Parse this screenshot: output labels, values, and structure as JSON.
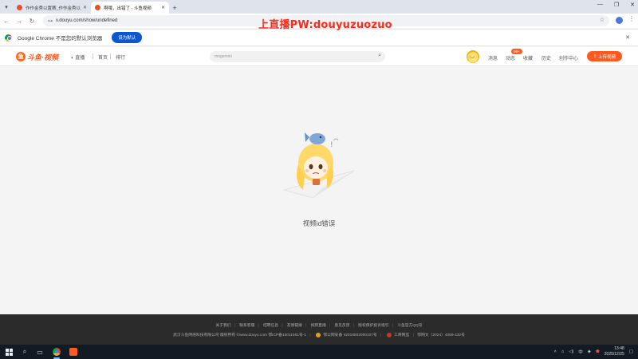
{
  "browser": {
    "tabs": [
      {
        "title": "作作金秀以置赛_作作金秀以赛",
        "active": false
      },
      {
        "title": "啊哦，出错了 - 斗鱼视频",
        "active": true
      }
    ],
    "address": "v.douyu.com/show/undefined",
    "infobar": {
      "message": "Google Chrome 不是您的默认浏览器",
      "button": "设为默认"
    }
  },
  "overlay": {
    "text": "上直播PW:douyuzuozuo",
    "color": "#ff2a1a"
  },
  "site": {
    "logo_text": "斗鱼·视频",
    "nav": [
      "直播",
      "首页",
      "排行"
    ],
    "search_placeholder": "mogemini",
    "header_links": [
      "消息",
      "动态",
      "收藏",
      "历史",
      "创作中心"
    ],
    "notify_badge": "99+",
    "upload_button": "上传视频",
    "brand_color": "#ff5a1f"
  },
  "main": {
    "error_message": "视频id错误"
  },
  "footer": {
    "links": [
      "关于我们",
      "联系客服",
      "招聘信息",
      "友情链接",
      "视频直播",
      "意见反馈",
      "版权保护投诉指引",
      "斗鱼官方QQ号"
    ],
    "copyright": "武汉斗鱼网络科技有限公司 版权所有 ©www.douyu.com",
    "icp": "鄂ICP备15011561号-1",
    "police": "鄂公网安备 42018502000107号",
    "commerce": "工商网监",
    "culture": "鄂网文（2024）4069-432号"
  },
  "taskbar": {
    "time": "13:48",
    "date": "2025/12/25",
    "lang": "中"
  }
}
